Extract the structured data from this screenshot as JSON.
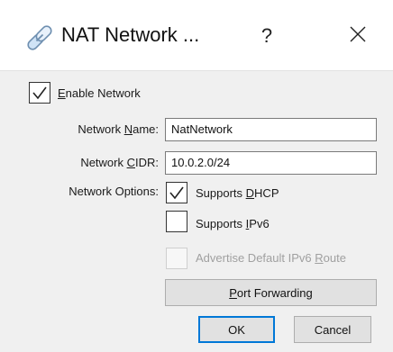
{
  "dialog": {
    "title": "NAT Network ...",
    "help_symbol": "?",
    "app_icon": "link-icon",
    "close_icon": "close-icon"
  },
  "enable_network": {
    "label_mnemonic": "E",
    "label_rest": "nable Network",
    "checked": true
  },
  "fields": {
    "name_label_pre": "Network ",
    "name_label_mnemonic": "N",
    "name_label_post": "ame:",
    "name_value": "NatNetwork",
    "cidr_label_pre": "Network ",
    "cidr_label_mnemonic": "C",
    "cidr_label_post": "IDR:",
    "cidr_value": "10.0.2.0/24",
    "options_label": "Network Options:"
  },
  "options": {
    "dhcp_label_pre": "Supports ",
    "dhcp_label_mnemonic": "D",
    "dhcp_label_post": "HCP",
    "dhcp_checked": true,
    "ipv6_label_pre": "Supports ",
    "ipv6_label_mnemonic": "I",
    "ipv6_label_post": "Pv6",
    "ipv6_checked": false,
    "route_label_pre": "Advertise Default IPv6 ",
    "route_label_mnemonic": "R",
    "route_label_post": "oute",
    "route_checked": false,
    "route_enabled": false
  },
  "buttons": {
    "port_forwarding_mnemonic": "P",
    "port_forwarding_rest": "ort Forwarding",
    "ok": "OK",
    "cancel": "Cancel"
  }
}
